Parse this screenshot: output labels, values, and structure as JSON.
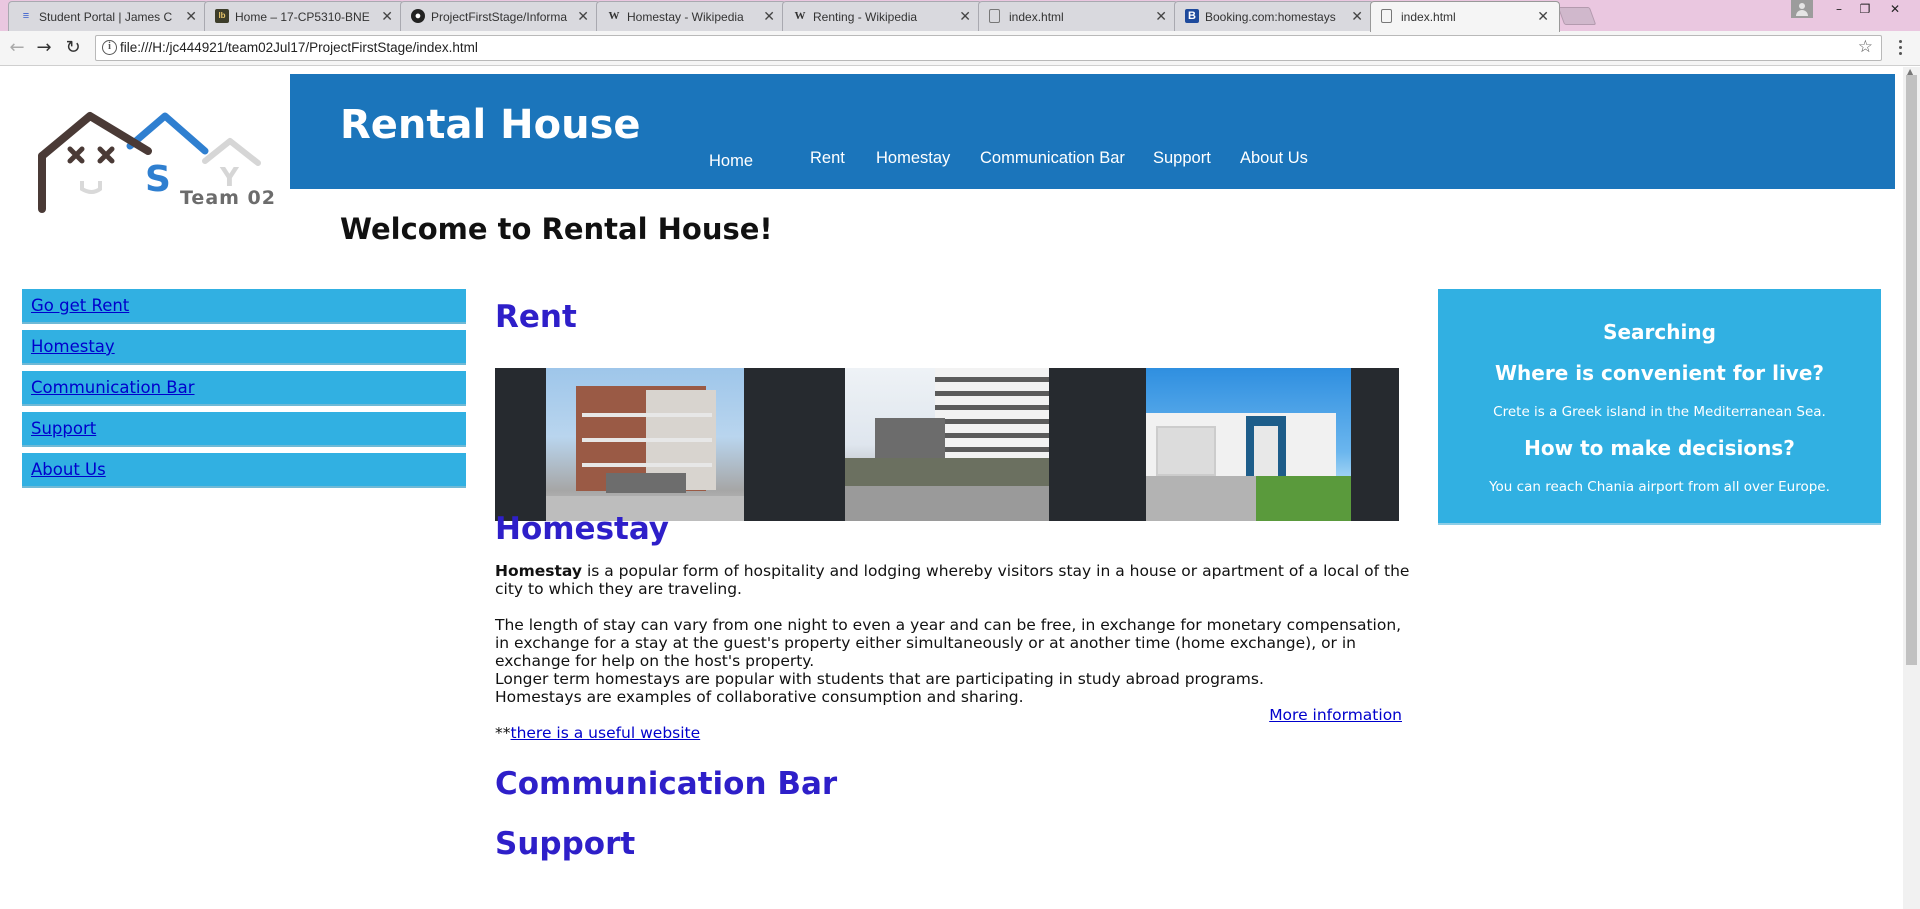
{
  "browser": {
    "tabs": [
      {
        "title": "Student Portal | James C",
        "icon": "page-icon"
      },
      {
        "title": "Home – 17-CP5310-BNE",
        "icon": "learnjcu-icon"
      },
      {
        "title": "ProjectFirstStage/Informa",
        "icon": "github-icon"
      },
      {
        "title": "Homestay - Wikipedia",
        "icon": "wikipedia-icon"
      },
      {
        "title": "Renting - Wikipedia",
        "icon": "wikipedia-icon"
      },
      {
        "title": "index.html",
        "icon": "file-icon"
      },
      {
        "title": "Booking.com:homestays",
        "icon": "booking-icon"
      },
      {
        "title": "index.html",
        "icon": "file-icon"
      }
    ],
    "active_tab": 7,
    "url": "file:///H:/jc444921/team02Jul17/ProjectFirstStage/index.html"
  },
  "logo": {
    "team": "Team  02",
    "letters": [
      "S",
      "Y"
    ]
  },
  "header": {
    "title": "Rental House",
    "nav": [
      "Home",
      "Rent",
      "Homestay",
      "Communication Bar",
      "Support",
      "About Us"
    ]
  },
  "welcome": "Welcome to Rental House!",
  "sidebar": {
    "items": [
      "Go get Rent",
      "Homestay",
      "Communication Bar",
      "Support",
      "About Us"
    ]
  },
  "main": {
    "rent_heading": "Rent",
    "homestay_heading": "Homestay",
    "homestay_bold": "Homestay",
    "homestay_p1": " is a popular form of hospitality and lodging whereby visitors stay in a house or apartment of a local of the city to which they are traveling.",
    "homestay_p2": "The length of stay can vary from one night to even a year and can be free, in exchange for monetary compensation, in exchange for a stay at the guest's property either simultaneously or at another time (home exchange), or in exchange for help on the host's property.",
    "homestay_p3": "Longer term homestays are popular with students that are participating in study abroad programs.",
    "homestay_p4": "Homestays are examples of collaborative consumption and sharing.",
    "more_link": "More information",
    "useful_prefix": "**",
    "useful_link": "there is a useful website",
    "comm_heading": "Communication Bar",
    "support_heading": "Support"
  },
  "aside": {
    "heading1": "Searching",
    "heading2": "Where is convenient for live?",
    "text1": "Crete is a Greek island in the Mediterranean Sea.",
    "heading3": "How to make decisions?",
    "text2": "You can reach Chania airport from all over Europe."
  },
  "colors": {
    "banner": "#1b75bb",
    "sidebar_item": "#31b0e2",
    "heading": "#2e1fc9",
    "link": "#0000cc"
  }
}
